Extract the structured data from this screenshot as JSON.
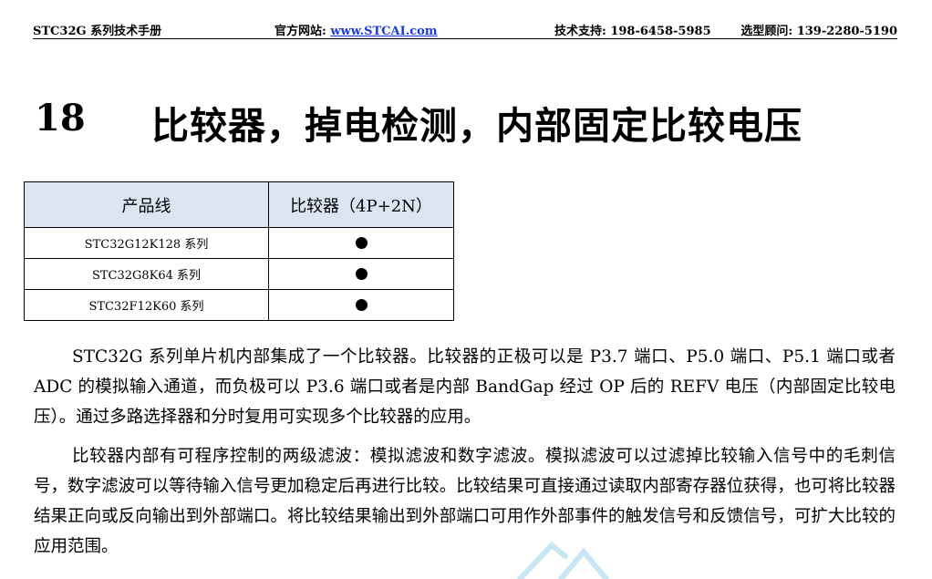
{
  "header": {
    "doc_title": "STC32G 系列技术手册",
    "site_label": "官方网站: ",
    "site_url": "www.STCAI.com",
    "support": "技术支持: 198-6458-5985",
    "sales": "选型顾问: 139-2280-5190"
  },
  "chapter": {
    "number": "18",
    "title": "比较器，掉电检测，内部固定比较电压"
  },
  "table": {
    "headers": [
      "产品线",
      "比较器（4P+2N）"
    ],
    "rows": [
      {
        "product": "STC32G12K128 系列",
        "has_comparator": true
      },
      {
        "product": "STC32G8K64 系列",
        "has_comparator": true
      },
      {
        "product": "STC32F12K60 系列",
        "has_comparator": true
      }
    ]
  },
  "paragraphs": [
    "STC32G 系列单片机内部集成了一个比较器。比较器的正极可以是 P3.7 端口、P5.0 端口、P5.1 端口或者 ADC 的模拟输入通道，而负极可以 P3.6 端口或者是内部 BandGap 经过 OP 后的 REFV 电压（内部固定比较电压）。通过多路选择器和分时复用可实现多个比较器的应用。",
    "比较器内部有可程序控制的两级滤波：模拟滤波和数字滤波。模拟滤波可以过滤掉比较输入信号中的毛刺信号，数字滤波可以等待输入信号更加稳定后再进行比较。比较结果可直接通过读取内部寄存器位获得，也可将比较器结果正向或反向输出到外部端口。将比较结果输出到外部端口可用作外部事件的触发信号和反馈信号，可扩大比较的应用范围。"
  ],
  "colors": {
    "table_header_bg": "#dbe5f1",
    "link": "#1a3bd6",
    "watermark": "#c9e6f5"
  }
}
